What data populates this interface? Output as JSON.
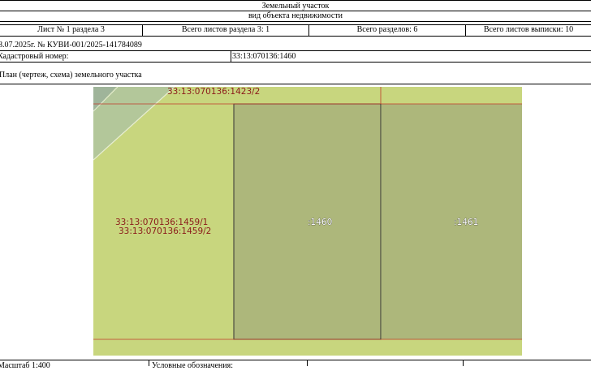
{
  "header": {
    "title": "Земельный участок",
    "subtitle": "вид объекта недвижимости"
  },
  "info_row": {
    "sheet": "Лист № 1 раздела 3",
    "sheets_in_section": "Всего листов раздела 3: 1",
    "sections_total": "Всего разделов: 6",
    "sheets_total": "Всего листов выписки: 10"
  },
  "doc_ref": "8.07.2025г. № КУВИ-001/2025-141784089",
  "cadastral": {
    "label": "Кадастровый номер:",
    "value": "33:13:070136:1460"
  },
  "plan_caption": "План (чертеж, схема) земельного участка",
  "plan": {
    "labels": {
      "top": "33:13:070136:1423/2",
      "left_1": "33:13:070136:1459/1",
      "left_2": "33:13:070136:1459/2",
      "center": ":1460",
      "right": ":1461"
    },
    "colors": {
      "light_green": "#c8d67e",
      "dark_green": "#adb77b",
      "grey_green": "#b3c79a",
      "boundary_red": "#c0392b"
    }
  },
  "footer": {
    "scale": "Масштаб 1:400",
    "legend": "Условные обозначения:"
  }
}
